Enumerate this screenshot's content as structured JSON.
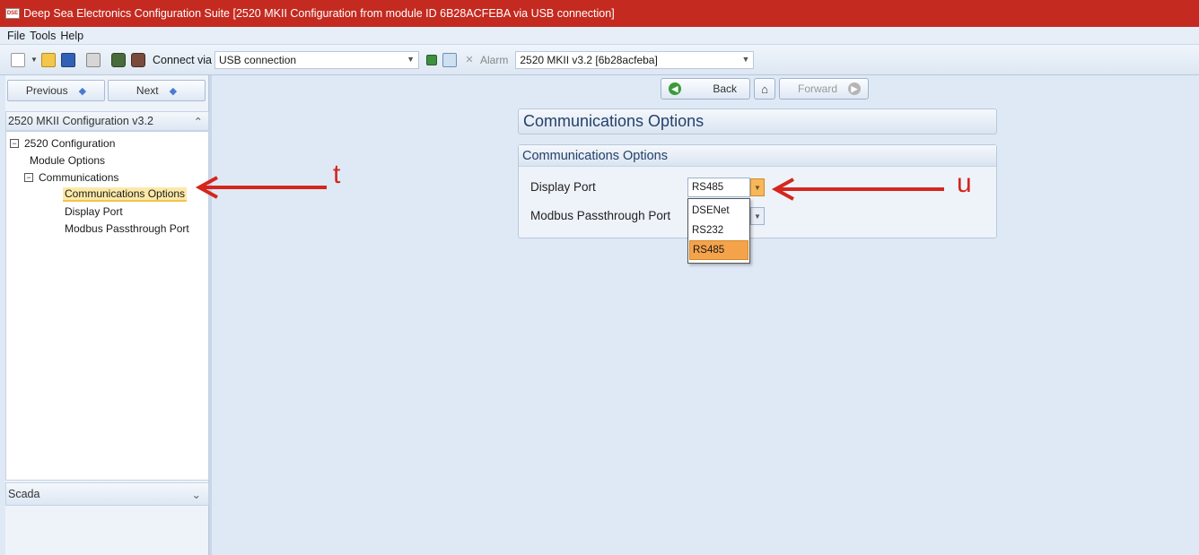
{
  "window": {
    "title": "Deep Sea Electronics Configuration Suite [2520 MKII Configuration from module ID 6B28ACFEBA via USB connection]",
    "icon_text": "DSE"
  },
  "menu": [
    "File",
    "Tools",
    "Help"
  ],
  "toolbar": {
    "connect_label": "Connect via",
    "connect_value": "USB connection",
    "alarm_label": "Alarm",
    "module_value": "2520 MKII v3.2 [6b28acfeba]"
  },
  "nav": {
    "previous": "Previous",
    "next": "Next",
    "back": "Back",
    "forward": "Forward"
  },
  "tree": {
    "header": "2520 MKII Configuration v3.2",
    "root": "2520 Configuration",
    "module_options": "Module Options",
    "communications": "Communications",
    "communications_options": "Communications Options",
    "display_port": "Display Port",
    "modbus_passthrough_port": "Modbus Passthrough Port"
  },
  "scada": {
    "header": "Scada"
  },
  "main": {
    "title": "Communications Options",
    "group_title": "Communications Options",
    "display_port_label": "Display Port",
    "display_port_value": "RS485",
    "modbus_label": "Modbus Passthrough Port",
    "dropdown_options": [
      "DSENet",
      "RS232",
      "RS485"
    ],
    "dropdown_selected": "RS485"
  },
  "annotations": {
    "t": "t",
    "u": "u",
    "color": "#d4261f"
  },
  "colors": {
    "titlebar": "#c42a20",
    "selection": "#fce9a8",
    "dropdown_highlight": "#f5a34a"
  }
}
